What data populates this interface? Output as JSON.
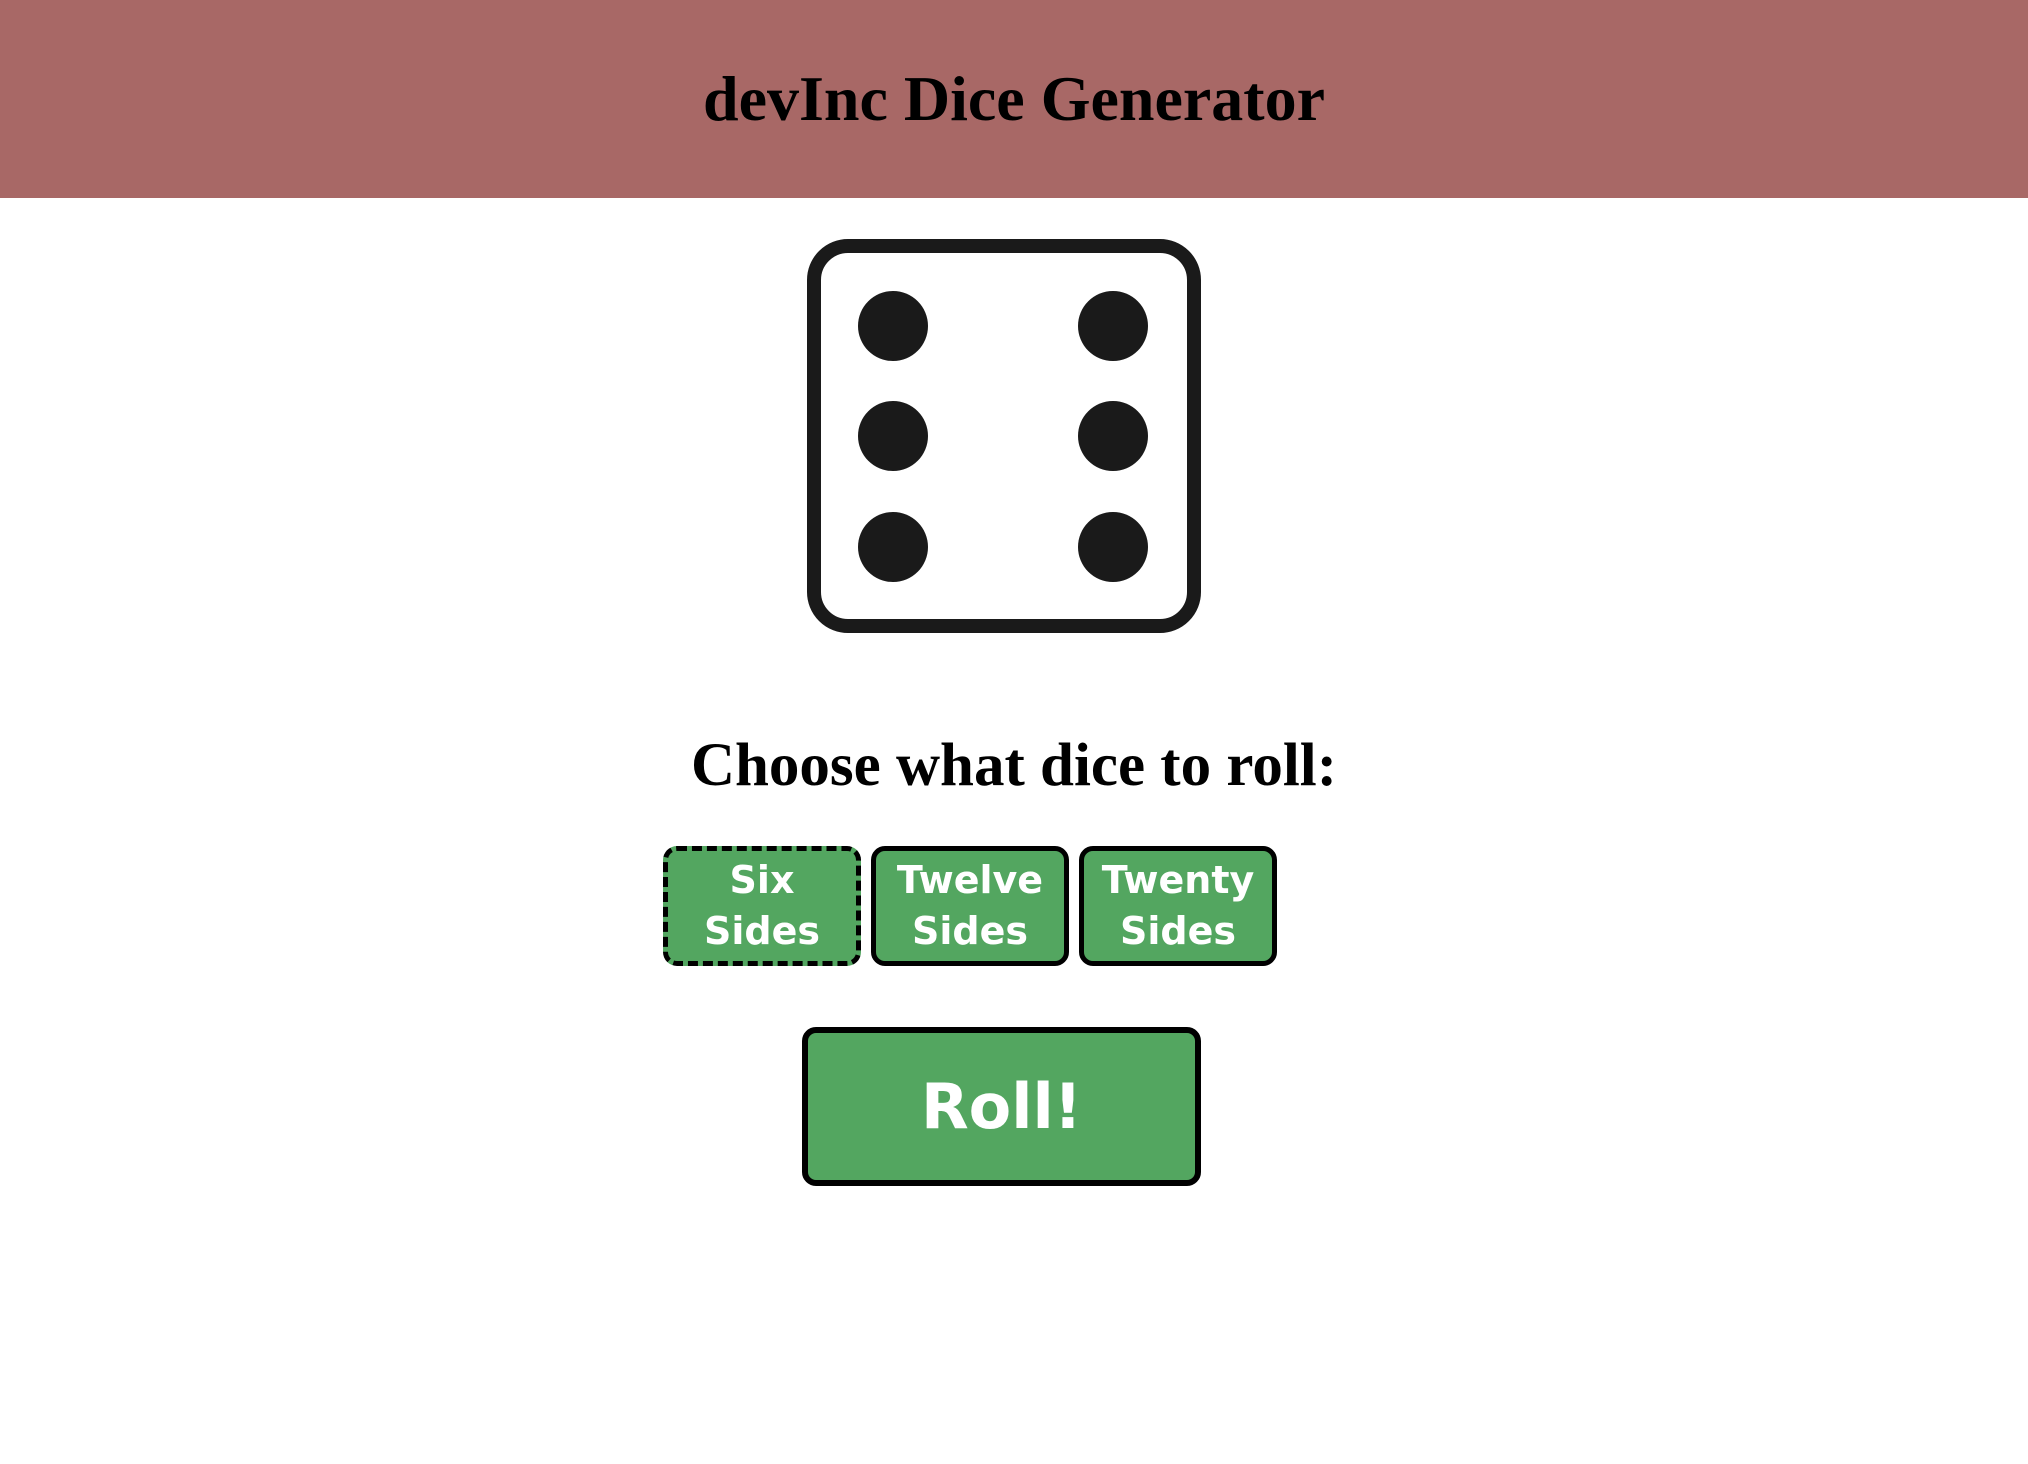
{
  "header": {
    "title": "devInc Dice Generator",
    "background_color": "#a86866"
  },
  "die": {
    "icon": "die-six-icon",
    "face_value": 6
  },
  "prompt": {
    "text": "Choose what dice to roll:"
  },
  "dice_options": [
    {
      "label": "Six Sides",
      "selected": true
    },
    {
      "label": "Twelve Sides",
      "selected": false
    },
    {
      "label": "Twenty Sides",
      "selected": false
    }
  ],
  "roll_button": {
    "label": "Roll!"
  },
  "colors": {
    "button_green": "#53a660",
    "button_text": "#ffffff",
    "border": "#000000"
  }
}
